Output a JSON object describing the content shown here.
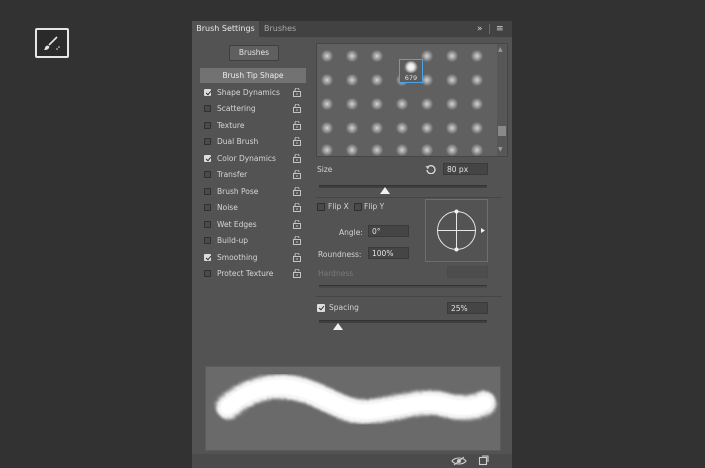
{
  "tool": {
    "icon": "brush-tool-icon"
  },
  "panel": {
    "tabs": [
      {
        "label": "Brush Settings",
        "active": true
      },
      {
        "label": "Brushes",
        "active": false
      }
    ],
    "header_icons": {
      "collapse": "»",
      "menu": "≡"
    },
    "brushes_button": "Brushes",
    "brush_tip_shape": "Brush Tip Shape",
    "items": [
      {
        "label": "Shape Dynamics",
        "checked": true
      },
      {
        "label": "Scattering",
        "checked": false
      },
      {
        "label": "Texture",
        "checked": false
      },
      {
        "label": "Dual Brush",
        "checked": false
      },
      {
        "label": "Color Dynamics",
        "checked": true
      },
      {
        "label": "Transfer",
        "checked": false
      },
      {
        "label": "Brush Pose",
        "checked": false
      },
      {
        "label": "Noise",
        "checked": false
      },
      {
        "label": "Wet Edges",
        "checked": false
      },
      {
        "label": "Build-up",
        "checked": false
      },
      {
        "label": "Smoothing",
        "checked": true
      },
      {
        "label": "Protect Texture",
        "checked": false
      }
    ],
    "selected_brush_size": "679",
    "size": {
      "label": "Size",
      "value": "80 px"
    },
    "flip_x": {
      "label": "Flip X",
      "checked": false
    },
    "flip_y": {
      "label": "Flip Y",
      "checked": false
    },
    "angle": {
      "label": "Angle:",
      "value": "0°"
    },
    "roundness": {
      "label": "Roundness:",
      "value": "100%"
    },
    "hardness": {
      "label": "Hardness"
    },
    "spacing": {
      "label": "Spacing",
      "checked": true,
      "value": "25%"
    },
    "footer_icons": [
      "eye-toggle-icon",
      "new-brush-icon"
    ]
  }
}
